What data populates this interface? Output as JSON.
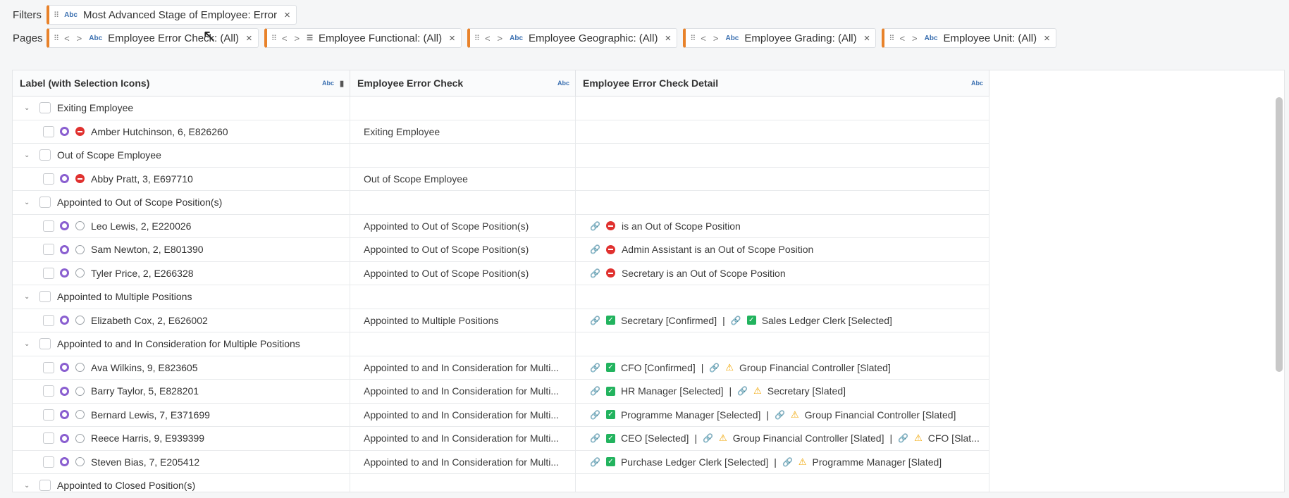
{
  "filters": {
    "label": "Filters",
    "items": [
      {
        "type": "Abc",
        "text": "Most Advanced Stage of Employee: Error"
      }
    ]
  },
  "pages": {
    "label": "Pages",
    "items": [
      {
        "type": "Abc",
        "text": "Employee Error Check: (All)"
      },
      {
        "type": "list",
        "text": "Employee Functional: (All)"
      },
      {
        "type": "Abc",
        "text": "Employee Geographic: (All)"
      },
      {
        "type": "Abc",
        "text": "Employee Grading: (All)"
      },
      {
        "type": "Abc",
        "text": "Employee Unit: (All)"
      }
    ]
  },
  "grid": {
    "columns": [
      "Label (with Selection Icons)",
      "Employee Error Check",
      "Employee Error Check Detail"
    ],
    "col_type": "Abc",
    "rows": [
      {
        "kind": "group",
        "label": "Exiting Employee"
      },
      {
        "kind": "item",
        "label": "Amber Hutchinson, 6, E826260",
        "status": "stop",
        "check": "Exiting Employee",
        "detail": []
      },
      {
        "kind": "group",
        "label": "Out of Scope Employee"
      },
      {
        "kind": "item",
        "label": "Abby Pratt, 3, E697710",
        "status": "stop",
        "check": "Out of Scope Employee",
        "detail": []
      },
      {
        "kind": "group",
        "label": "Appointed to Out of Scope Position(s)"
      },
      {
        "kind": "item",
        "label": "Leo Lewis, 2, E220026",
        "status": "empty",
        "check": "Appointed to Out of Scope Position(s)",
        "detail": [
          {
            "icon": "stop",
            "text": "is an Out of Scope Position"
          }
        ]
      },
      {
        "kind": "item",
        "label": "Sam Newton, 2, E801390",
        "status": "empty",
        "check": "Appointed to Out of Scope Position(s)",
        "detail": [
          {
            "icon": "stop",
            "text": "Admin Assistant is an Out of Scope Position"
          }
        ]
      },
      {
        "kind": "item",
        "label": "Tyler Price, 2, E266328",
        "status": "empty",
        "check": "Appointed to Out of Scope Position(s)",
        "detail": [
          {
            "icon": "stop",
            "text": "Secretary is an Out of Scope Position"
          }
        ]
      },
      {
        "kind": "group",
        "label": "Appointed to Multiple Positions"
      },
      {
        "kind": "item",
        "label": "Elizabeth Cox, 2, E626002",
        "status": "empty",
        "check": "Appointed to Multiple Positions",
        "detail": [
          {
            "icon": "ok",
            "text": "Secretary [Confirmed]"
          },
          {
            "icon": "ok",
            "text": "Sales Ledger Clerk [Selected]"
          }
        ]
      },
      {
        "kind": "group",
        "label": "Appointed to and In Consideration for Multiple Positions"
      },
      {
        "kind": "item",
        "label": "Ava Wilkins, 9, E823605",
        "status": "empty",
        "check": "Appointed to and In Consideration for Multi...",
        "detail": [
          {
            "icon": "ok",
            "text": "CFO [Confirmed]"
          },
          {
            "icon": "warn",
            "text": "Group Financial Controller [Slated]"
          }
        ]
      },
      {
        "kind": "item",
        "label": "Barry Taylor, 5, E828201",
        "status": "empty",
        "check": "Appointed to and In Consideration for Multi...",
        "detail": [
          {
            "icon": "ok",
            "text": "HR Manager [Selected]"
          },
          {
            "icon": "warn",
            "text": "Secretary [Slated]"
          }
        ]
      },
      {
        "kind": "item",
        "label": "Bernard Lewis, 7, E371699",
        "status": "empty",
        "check": "Appointed to and In Consideration for Multi...",
        "detail": [
          {
            "icon": "ok",
            "text": "Programme Manager [Selected]"
          },
          {
            "icon": "warn",
            "text": "Group Financial Controller [Slated]"
          }
        ]
      },
      {
        "kind": "item",
        "label": "Reece Harris, 9, E939399",
        "status": "empty",
        "check": "Appointed to and In Consideration for Multi...",
        "detail": [
          {
            "icon": "ok",
            "text": "CEO [Selected]"
          },
          {
            "icon": "warn",
            "text": "Group Financial Controller [Slated]"
          },
          {
            "icon": "warn",
            "text": "CFO [Slat..."
          }
        ]
      },
      {
        "kind": "item",
        "label": "Steven Bias, 7, E205412",
        "status": "empty",
        "check": "Appointed to and In Consideration for Multi...",
        "detail": [
          {
            "icon": "ok",
            "text": "Purchase Ledger Clerk [Selected]"
          },
          {
            "icon": "warn",
            "text": "Programme Manager [Slated]"
          }
        ]
      },
      {
        "kind": "group",
        "label": "Appointed to Closed Position(s)"
      }
    ]
  }
}
